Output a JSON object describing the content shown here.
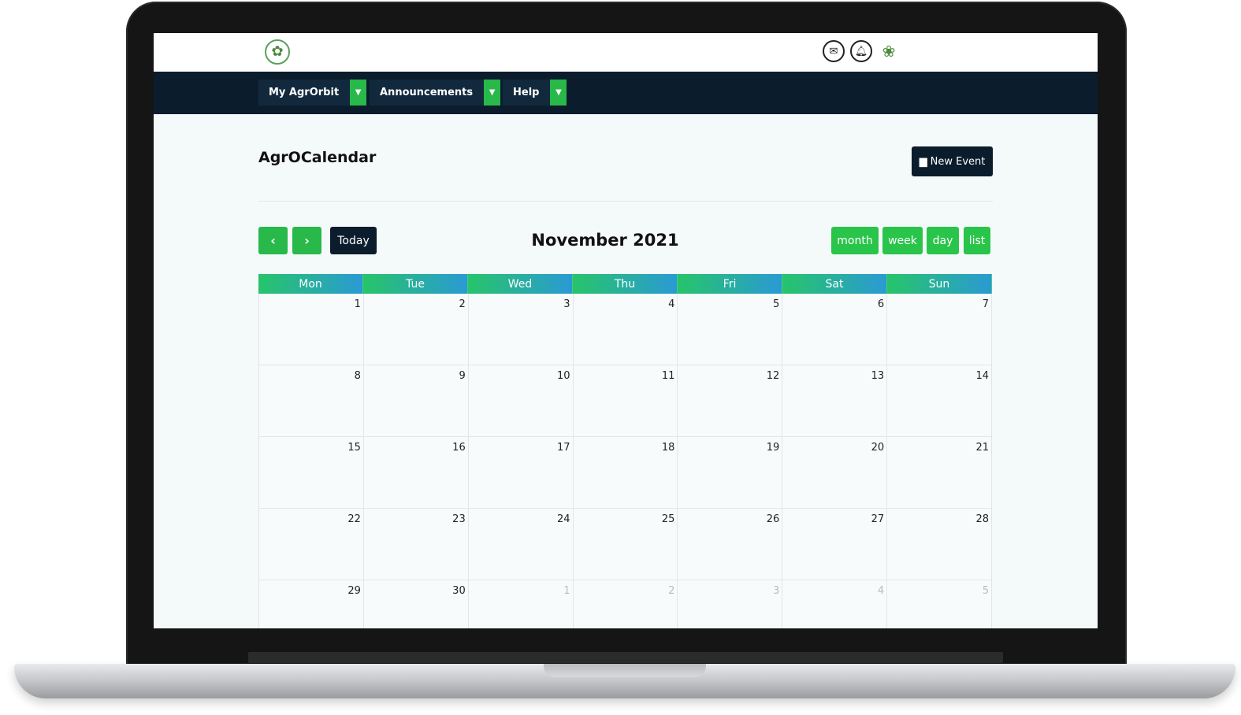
{
  "topbar": {
    "logo_icon": "flower-logo",
    "icons": [
      "mail-icon",
      "bell-icon",
      "plant-avatar-icon"
    ]
  },
  "nav": {
    "items": [
      {
        "label": "My AgrOrbit"
      },
      {
        "label": "Announcements"
      },
      {
        "label": "Help"
      }
    ]
  },
  "page": {
    "title": "AgrOCalendar",
    "new_event_label": "New Event"
  },
  "calendar": {
    "title": "November 2021",
    "today_label": "Today",
    "prev_label": "‹",
    "next_label": "›",
    "views": [
      "month",
      "week",
      "day",
      "list"
    ],
    "weekdays": [
      "Mon",
      "Tue",
      "Wed",
      "Thu",
      "Fri",
      "Sat",
      "Sun"
    ],
    "weeks": [
      [
        {
          "n": "1"
        },
        {
          "n": "2"
        },
        {
          "n": "3"
        },
        {
          "n": "4"
        },
        {
          "n": "5"
        },
        {
          "n": "6"
        },
        {
          "n": "7"
        }
      ],
      [
        {
          "n": "8"
        },
        {
          "n": "9"
        },
        {
          "n": "10"
        },
        {
          "n": "11"
        },
        {
          "n": "12"
        },
        {
          "n": "13"
        },
        {
          "n": "14"
        }
      ],
      [
        {
          "n": "15"
        },
        {
          "n": "16"
        },
        {
          "n": "17"
        },
        {
          "n": "18"
        },
        {
          "n": "19"
        },
        {
          "n": "20"
        },
        {
          "n": "21"
        }
      ],
      [
        {
          "n": "22"
        },
        {
          "n": "23"
        },
        {
          "n": "24"
        },
        {
          "n": "25"
        },
        {
          "n": "26"
        },
        {
          "n": "27"
        },
        {
          "n": "28"
        }
      ],
      [
        {
          "n": "29"
        },
        {
          "n": "30"
        },
        {
          "n": "1",
          "other": true
        },
        {
          "n": "2",
          "other": true
        },
        {
          "n": "3",
          "other": true
        },
        {
          "n": "4",
          "other": true
        },
        {
          "n": "5",
          "other": true
        }
      ]
    ]
  },
  "colors": {
    "navbar": "#0b1c2c",
    "accent_green": "#29b84a",
    "header_gradient_start": "#27c46a",
    "header_gradient_end": "#2a9ad4"
  }
}
